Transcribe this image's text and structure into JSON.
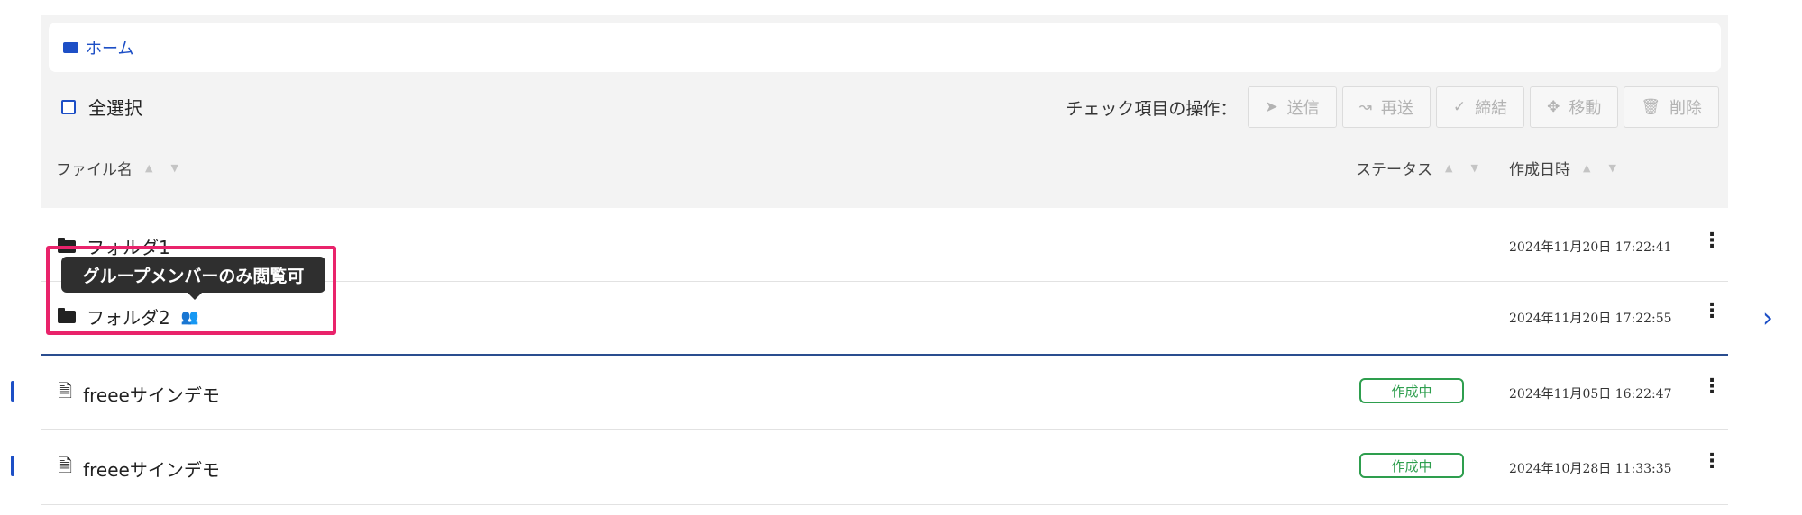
{
  "breadcrumb": {
    "home": "ホーム"
  },
  "toolbar": {
    "select_all": "全選択",
    "ops_label": "チェック項目の操作：",
    "buttons": [
      {
        "icon": "send-icon",
        "glyph": "➤",
        "label": "送信"
      },
      {
        "icon": "resend-icon",
        "glyph": "↝",
        "label": "再送"
      },
      {
        "icon": "check-icon",
        "glyph": "✓",
        "label": "締結"
      },
      {
        "icon": "move-icon",
        "glyph": "✥",
        "label": "移動"
      },
      {
        "icon": "trash-icon",
        "glyph": "🗑",
        "label": "削除"
      }
    ]
  },
  "table": {
    "columns": {
      "name": "ファイル名",
      "status": "ステータス",
      "created": "作成日時"
    },
    "rows": [
      {
        "type": "folder",
        "name": "フォルダ1",
        "status": "",
        "created": "2024年11月20日 17:22:41"
      },
      {
        "type": "folder",
        "name": "フォルダ2",
        "status": "",
        "created": "2024年11月20日 17:22:55",
        "group_only": true
      },
      {
        "type": "document",
        "name": "freeeサインデモ",
        "status": "作成中",
        "created": "2024年11月05日 16:22:47"
      },
      {
        "type": "document",
        "name": "freeeサインデモ",
        "status": "作成中",
        "created": "2024年10月28日 11:33:35"
      }
    ]
  },
  "tooltip": {
    "text": "グループメンバーのみ閲覧可"
  },
  "colors": {
    "accent": "#1d4fc6",
    "status_green": "#2e9e4e",
    "highlight": "#e9236b"
  }
}
